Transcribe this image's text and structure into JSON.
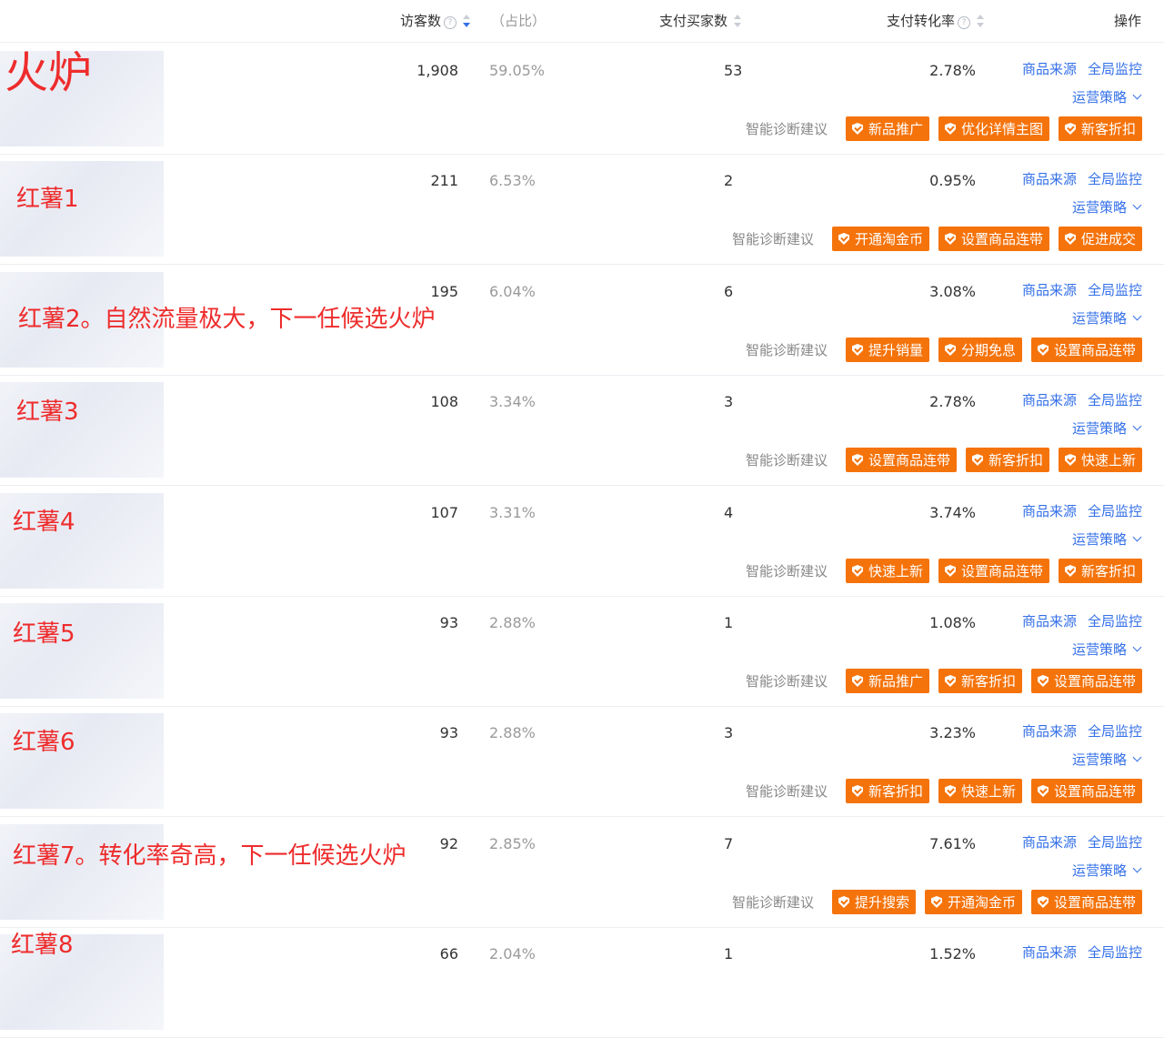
{
  "header": {
    "visitors": "访客数",
    "share": "（占比）",
    "buyers": "支付买家数",
    "conversion": "支付转化率",
    "action": "操作",
    "help_glyph": "?"
  },
  "labels": {
    "source": "商品来源",
    "monitor": "全局监控",
    "strategy": "运营策略",
    "diagnosis": "智能诊断建议"
  },
  "colors": {
    "accent": "#3470e8",
    "tag": "#f5730b",
    "annotation": "#ee2c2c"
  },
  "rows": [
    {
      "visitors": "1,908",
      "share": "59.05%",
      "buyers": "53",
      "rate": "2.78%",
      "tags": [
        "新品推广",
        "优化详情主图",
        "新客折扣"
      ]
    },
    {
      "visitors": "211",
      "share": "6.53%",
      "buyers": "2",
      "rate": "0.95%",
      "tags": [
        "开通淘金币",
        "设置商品连带",
        "促进成交"
      ]
    },
    {
      "visitors": "195",
      "share": "6.04%",
      "buyers": "6",
      "rate": "3.08%",
      "tags": [
        "提升销量",
        "分期免息",
        "设置商品连带"
      ]
    },
    {
      "visitors": "108",
      "share": "3.34%",
      "buyers": "3",
      "rate": "2.78%",
      "tags": [
        "设置商品连带",
        "新客折扣",
        "快速上新"
      ]
    },
    {
      "visitors": "107",
      "share": "3.31%",
      "buyers": "4",
      "rate": "3.74%",
      "tags": [
        "快速上新",
        "设置商品连带",
        "新客折扣"
      ]
    },
    {
      "visitors": "93",
      "share": "2.88%",
      "buyers": "1",
      "rate": "1.08%",
      "tags": [
        "新品推广",
        "新客折扣",
        "设置商品连带"
      ]
    },
    {
      "visitors": "93",
      "share": "2.88%",
      "buyers": "3",
      "rate": "3.23%",
      "tags": [
        "新客折扣",
        "快速上新",
        "设置商品连带"
      ]
    },
    {
      "visitors": "92",
      "share": "2.85%",
      "buyers": "7",
      "rate": "7.61%",
      "tags": [
        "提升搜索",
        "开通淘金币",
        "设置商品连带"
      ]
    },
    {
      "visitors": "66",
      "share": "2.04%",
      "buyers": "1",
      "rate": "1.52%",
      "tags": []
    }
  ],
  "annotations": [
    "火炉",
    "红薯1",
    "红薯2。自然流量极大，下一任候选火炉",
    "红薯3",
    "红薯4",
    "红薯5",
    "红薯6",
    "红薯7。转化率奇高，下一任候选火炉",
    "红薯8"
  ]
}
